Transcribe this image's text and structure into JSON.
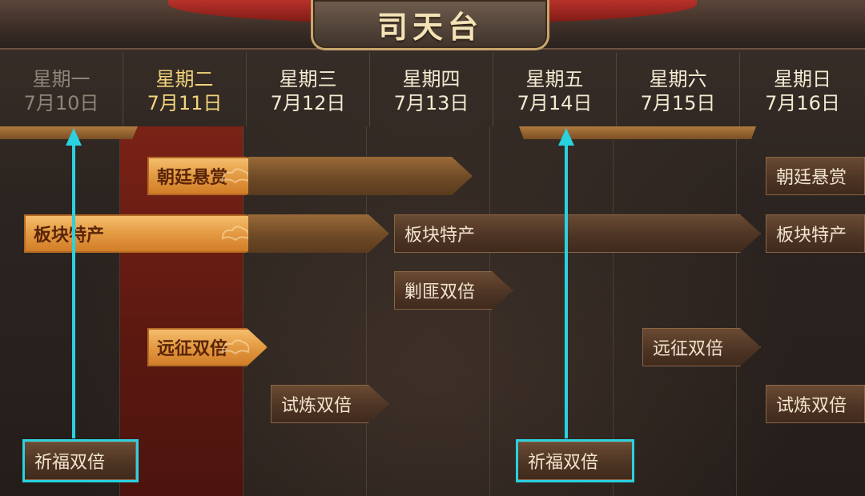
{
  "title": "司天台",
  "days": [
    {
      "name": "星期一",
      "date": "7月10日",
      "state": "past"
    },
    {
      "name": "星期二",
      "date": "7月11日",
      "state": "today"
    },
    {
      "name": "星期三",
      "date": "7月12日",
      "state": "future"
    },
    {
      "name": "星期四",
      "date": "7月13日",
      "state": "future"
    },
    {
      "name": "星期五",
      "date": "7月14日",
      "state": "future"
    },
    {
      "name": "星期六",
      "date": "7月15日",
      "state": "future"
    },
    {
      "name": "星期日",
      "date": "7月16日",
      "state": "future"
    }
  ],
  "events": {
    "bounty_1": "朝廷悬赏",
    "bounty_2": "朝廷悬赏",
    "specialty_1": "板块特产",
    "specialty_2": "板块特产",
    "specialty_3": "板块特产",
    "bandit": "剿匪双倍",
    "expedition_1": "远征双倍",
    "expedition_2": "远征双倍",
    "trial_1": "试炼双倍",
    "trial_2": "试炼双倍",
    "blessing_1": "祈福双倍",
    "blessing_2": "祈福双倍"
  },
  "colors": {
    "highlight": "#2ad1e0",
    "today_column": "#6a1d12",
    "bright_event": "#e39a42",
    "dark_event": "#4e3524"
  }
}
